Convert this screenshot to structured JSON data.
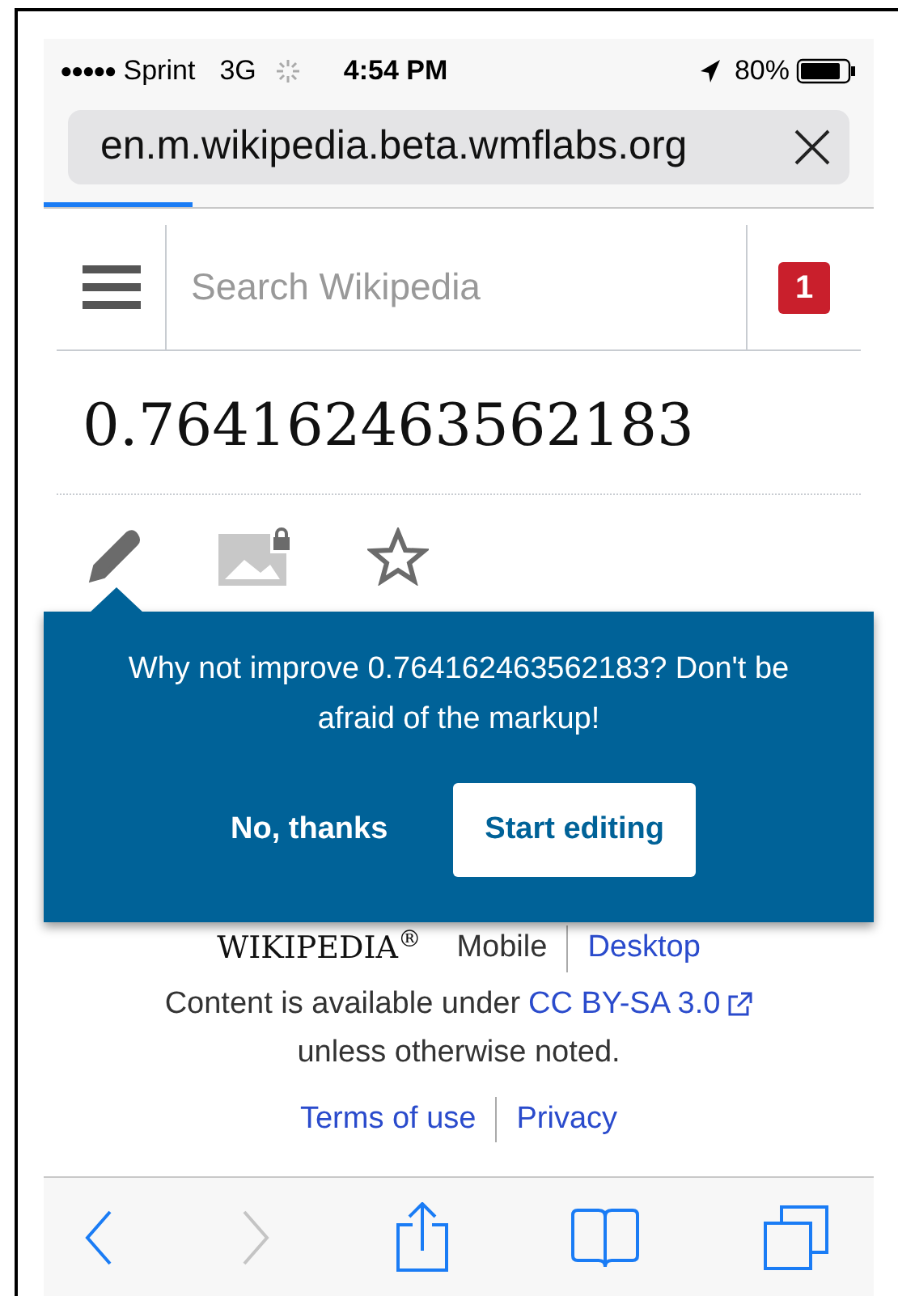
{
  "status_bar": {
    "signal_dots": "●●●●●",
    "carrier": "Sprint",
    "network": "3G",
    "time": "4:54 PM",
    "battery": "80%"
  },
  "address_bar": {
    "url": "en.m.wikipedia.beta.wmflabs.org"
  },
  "page_load": {
    "level": 0.18
  },
  "header": {
    "search": {
      "placeholder": "Search Wikipedia"
    },
    "notifications": "1"
  },
  "article": {
    "title": "0.764162463562183"
  },
  "page_actions": [
    {
      "kind": "edit",
      "disabled": false
    },
    {
      "kind": "image",
      "disabled": true
    },
    {
      "kind": "watch",
      "disabled": false
    }
  ],
  "edit_prompt": {
    "message": "Why not improve 0.764162463562183? Don't be afraid of the markup!",
    "buttons": [
      {
        "label": "No, thanks",
        "kind": "secondary"
      },
      {
        "label": "Start editing",
        "kind": "primary"
      }
    ]
  },
  "footer": {
    "wordmark": "WIKIPEDIA$^{®}$",
    "modes": [
      {
        "label": "Mobile",
        "selected": true
      },
      {
        "label": "Desktop",
        "selected": false
      }
    ],
    "license_prefix": "Content is available under",
    "license_link": "CC BY-SA 3.0",
    "license_suffix": "unless otherwise noted.",
    "links": [
      "Terms of use",
      "Privacy"
    ]
  },
  "toolbar": [
    {
      "kind": "back",
      "disabled": false
    },
    {
      "kind": "forward",
      "disabled": true
    },
    {
      "kind": "share",
      "disabled": false
    },
    {
      "kind": "bookmarks",
      "disabled": false
    },
    {
      "kind": "tabs",
      "disabled": false
    }
  ]
}
